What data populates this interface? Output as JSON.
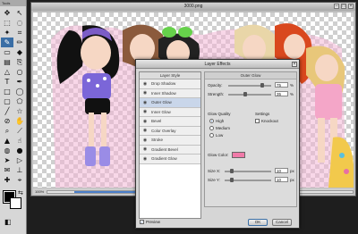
{
  "tools_panel": {
    "title": "Tools",
    "tools": [
      {
        "icon": "move-icon",
        "glyph": "✥"
      },
      {
        "icon": "arrow-icon",
        "glyph": "↖"
      },
      {
        "icon": "marquee-icon",
        "glyph": "⬚"
      },
      {
        "icon": "lasso-icon",
        "glyph": "◌"
      },
      {
        "icon": "magic-wand-icon",
        "glyph": "✦"
      },
      {
        "icon": "crop-icon",
        "glyph": "⌗"
      },
      {
        "icon": "brush-icon",
        "glyph": "✎"
      },
      {
        "icon": "pencil-icon",
        "glyph": "✏"
      },
      {
        "icon": "eraser-icon",
        "glyph": "▭"
      },
      {
        "icon": "bucket-icon",
        "glyph": "◆"
      },
      {
        "icon": "gradient-icon",
        "glyph": "▤"
      },
      {
        "icon": "clone-icon",
        "glyph": "⎘"
      },
      {
        "icon": "blur-icon",
        "glyph": "△"
      },
      {
        "icon": "dodge-icon",
        "glyph": "○"
      },
      {
        "icon": "text-icon",
        "glyph": "T"
      },
      {
        "icon": "pen-icon",
        "glyph": "✒"
      },
      {
        "icon": "rectangle-icon",
        "glyph": "□"
      },
      {
        "icon": "ellipse-icon",
        "glyph": "◯"
      },
      {
        "icon": "rounded-rect-icon",
        "glyph": "▢"
      },
      {
        "icon": "polygon-icon",
        "glyph": "⬠"
      },
      {
        "icon": "line-icon",
        "glyph": "╱"
      },
      {
        "icon": "star-icon",
        "glyph": "☆"
      },
      {
        "icon": "eyedropper-icon",
        "glyph": "⊘"
      },
      {
        "icon": "hand-icon",
        "glyph": "✋"
      },
      {
        "icon": "zoom-icon",
        "glyph": "⌕"
      },
      {
        "icon": "slice-icon",
        "glyph": "⟋"
      },
      {
        "icon": "sharpen-icon",
        "glyph": "▲"
      },
      {
        "icon": "smudge-icon",
        "glyph": "☝"
      },
      {
        "icon": "sponge-icon",
        "glyph": "◍"
      },
      {
        "icon": "burn-icon",
        "glyph": "●"
      },
      {
        "icon": "path-select-icon",
        "glyph": "➤"
      },
      {
        "icon": "direct-select-icon",
        "glyph": "▷"
      },
      {
        "icon": "notes-icon",
        "glyph": "✉"
      },
      {
        "icon": "measure-icon",
        "glyph": "⊥"
      },
      {
        "icon": "heal-icon",
        "glyph": "✚"
      },
      {
        "icon": "patch-icon",
        "glyph": "⌖"
      }
    ],
    "active_index": 6
  },
  "document": {
    "title": "3000.png",
    "zoom": "100%"
  },
  "dialog": {
    "title": "Layer Effects",
    "list_header": "Layer Style",
    "styles": [
      "Drop Shadow",
      "Inner Shadow",
      "Outer Glow",
      "Inner Glow",
      "Bevel",
      "Color Overlay",
      "Stroke",
      "Gradient Bevel",
      "Gradient Glow"
    ],
    "selected_index": 2,
    "preview_label": "Preview",
    "panel_title": "Outer Glow",
    "opacity_label": "Opacity:",
    "opacity_value": "75",
    "opacity_unit": "%",
    "strength_label": "Strength:",
    "strength_value": "35",
    "strength_unit": "%",
    "glow_quality_label": "Glow Quality",
    "quality_options": [
      "High",
      "Medium",
      "Low"
    ],
    "settings_label": "Settings",
    "knockout_label": "Knockout",
    "glow_color_label": "Glow Color:",
    "glow_color": "#f07aa8",
    "size_x_label": "Size X:",
    "size_x_value": "10",
    "size_y_label": "Size Y:",
    "size_y_value": "10",
    "px_unit": "px",
    "ok_label": "OK",
    "cancel_label": "Cancel"
  }
}
